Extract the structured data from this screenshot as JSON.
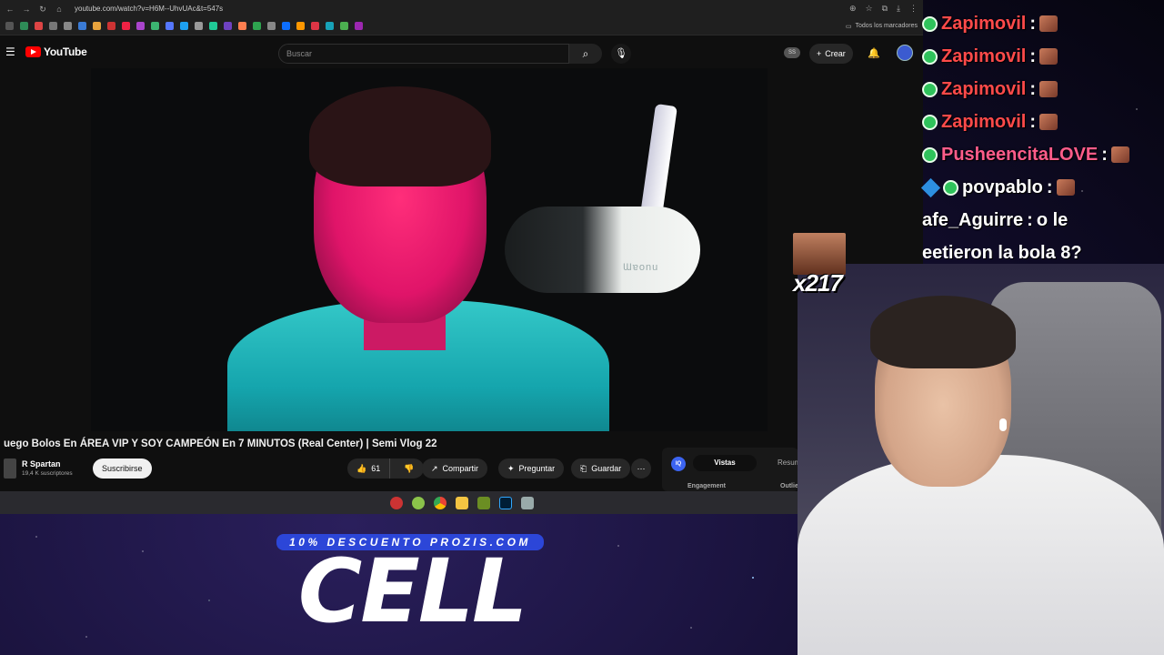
{
  "browser": {
    "url": "youtube.com/watch?v=H6M--UhvUAc&t=547s",
    "bookmarks_folder_label": "Todos los marcadores"
  },
  "youtube": {
    "logo_text": "YouTube",
    "search_placeholder": "Buscar",
    "ss_badge": "SS",
    "create_label": "Crear",
    "video_title": "uego Bolos En ÁREA VIP Y SOY CAMPEÓN En 7 MINUTOS (Real Center) | Semi Vlog 22",
    "channel_name": "R Spartan",
    "channel_subs": "19,4 K suscriptores",
    "subscribe_label": "Suscribirse",
    "like_count": "61",
    "share_label": "Compartir",
    "ask_label": "Preguntar",
    "save_label": "Guardar",
    "mic_brand": "Ɯɐonu",
    "side_panel": {
      "logo": "IQ",
      "tab_active": "Vistas",
      "tab_other": "Resum",
      "section_engagement": "Engagement",
      "section_outlier": "Outlie"
    }
  },
  "promo": {
    "badge": "10% DESCUENTO PROZIS.COM",
    "code": "CELL"
  },
  "chat": [
    {
      "user": "Zapimovil",
      "sep": ":",
      "message": "",
      "style": "red",
      "badge": "green",
      "emote": true
    },
    {
      "user": "Zapimovil",
      "sep": ":",
      "message": "",
      "style": "red",
      "badge": "green",
      "emote": true
    },
    {
      "user": "Zapimovil",
      "sep": ":",
      "message": "",
      "style": "red",
      "badge": "green",
      "emote": true
    },
    {
      "user": "Zapimovil",
      "sep": ":",
      "message": "",
      "style": "red",
      "badge": "green",
      "emote": true
    },
    {
      "user": "PusheencitaLOVE",
      "sep": ":",
      "message": "",
      "style": "pink",
      "badge": "green",
      "emote": true
    },
    {
      "user": "povpablo",
      "sep": ":",
      "message": "",
      "style": "white",
      "badge": "cube-green",
      "emote": true
    },
    {
      "user": "afe_Aguirre",
      "sep": ":",
      "message": "o le",
      "style": "white",
      "badge": "none",
      "emote": false
    },
    {
      "user": "",
      "sep": "",
      "message": "eetieron la bola 8?",
      "style": "white",
      "badge": "none",
      "emote": false
    }
  ],
  "emote_overlay": {
    "count": "x217"
  },
  "colors": {
    "youtube_red": "#ff0000",
    "promo_blue": "#2c46d8",
    "chat_red": "#ff4a4a"
  },
  "icons": [
    "back-icon",
    "forward-icon",
    "reload-icon",
    "home-icon",
    "hamburger-icon",
    "search-icon",
    "mic-icon",
    "plus-icon",
    "bell-icon",
    "thumbs-up-icon",
    "thumbs-down-icon",
    "share-icon",
    "sparkle-icon",
    "bookmark-icon",
    "more-icon"
  ]
}
